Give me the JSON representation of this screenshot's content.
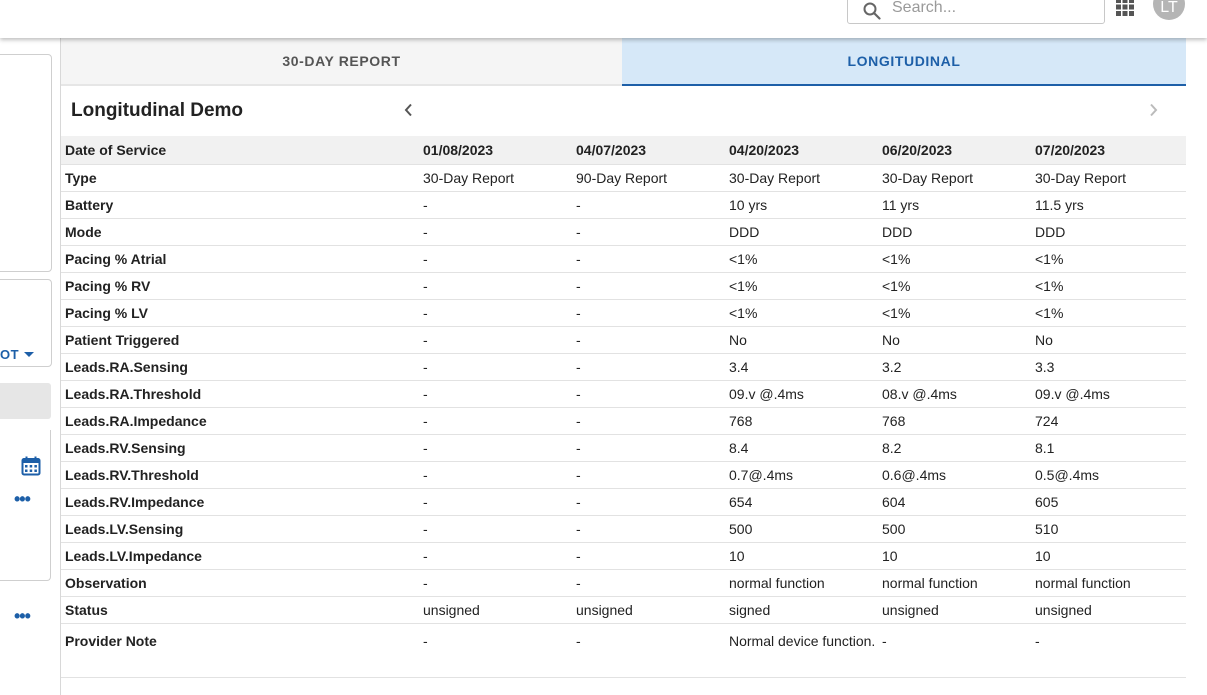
{
  "header": {
    "search_placeholder": "Search...",
    "avatar_initials": "LT"
  },
  "sidebar": {
    "dropdown_label": "OT"
  },
  "tabs": [
    {
      "label": "30-DAY REPORT",
      "active": false
    },
    {
      "label": "LONGITUDINAL",
      "active": true
    }
  ],
  "report": {
    "title": "Longitudinal Demo"
  },
  "table": {
    "header_label": "Date of Service",
    "dates": [
      "01/08/2023",
      "04/07/2023",
      "04/20/2023",
      "06/20/2023",
      "07/20/2023"
    ],
    "rows": [
      {
        "label": "Type",
        "values": [
          "30-Day Report",
          "90-Day Report",
          "30-Day Report",
          "30-Day Report",
          "30-Day Report"
        ]
      },
      {
        "label": "Battery",
        "values": [
          "-",
          "-",
          "10 yrs",
          "11 yrs",
          "11.5 yrs"
        ]
      },
      {
        "label": "Mode",
        "values": [
          "-",
          "-",
          "DDD",
          "DDD",
          "DDD"
        ]
      },
      {
        "label": "Pacing % Atrial",
        "values": [
          "-",
          "-",
          "<1%",
          "<1%",
          "<1%"
        ]
      },
      {
        "label": "Pacing % RV",
        "values": [
          "-",
          "-",
          "<1%",
          "<1%",
          "<1%"
        ]
      },
      {
        "label": "Pacing % LV",
        "values": [
          "-",
          "-",
          "<1%",
          "<1%",
          "<1%"
        ]
      },
      {
        "label": "Patient Triggered",
        "values": [
          "-",
          "-",
          "No",
          "No",
          "No"
        ]
      },
      {
        "label": "Leads.RA.Sensing",
        "values": [
          "-",
          "-",
          "3.4",
          "3.2",
          "3.3"
        ]
      },
      {
        "label": "Leads.RA.Threshold",
        "values": [
          "-",
          "-",
          "09.v @.4ms",
          "08.v @.4ms",
          "09.v @.4ms"
        ]
      },
      {
        "label": "Leads.RA.Impedance",
        "values": [
          "-",
          "-",
          "768",
          "768",
          "724"
        ]
      },
      {
        "label": "Leads.RV.Sensing",
        "values": [
          "-",
          "-",
          "8.4",
          "8.2",
          "8.1"
        ]
      },
      {
        "label": "Leads.RV.Threshold",
        "values": [
          "-",
          "-",
          "0.7@.4ms",
          "0.6@.4ms",
          "0.5@.4ms"
        ]
      },
      {
        "label": "Leads.RV.Impedance",
        "values": [
          "-",
          "-",
          "654",
          "604",
          "605"
        ]
      },
      {
        "label": "Leads.LV.Sensing",
        "values": [
          "-",
          "-",
          "500",
          "500",
          "510"
        ]
      },
      {
        "label": "Leads.LV.Impedance",
        "values": [
          "-",
          "-",
          "10",
          "10",
          "10"
        ]
      },
      {
        "label": "Observation",
        "values": [
          "-",
          "-",
          "normal function",
          "normal function",
          "normal function"
        ]
      },
      {
        "label": "Status",
        "values": [
          "unsigned",
          "unsigned",
          "signed",
          "unsigned",
          "unsigned"
        ]
      },
      {
        "label": "Provider Note",
        "values": [
          "-",
          "-",
          "Normal device function.",
          "-",
          "-"
        ]
      }
    ]
  },
  "colors": {
    "accent": "#1d5fa8",
    "active_tab_bg": "#d6e8f8"
  },
  "icons": [
    "search-icon",
    "apps-grid-icon",
    "calendar-icon",
    "more-dots-icon",
    "chevron-left-icon",
    "chevron-right-icon",
    "caret-down-icon"
  ]
}
